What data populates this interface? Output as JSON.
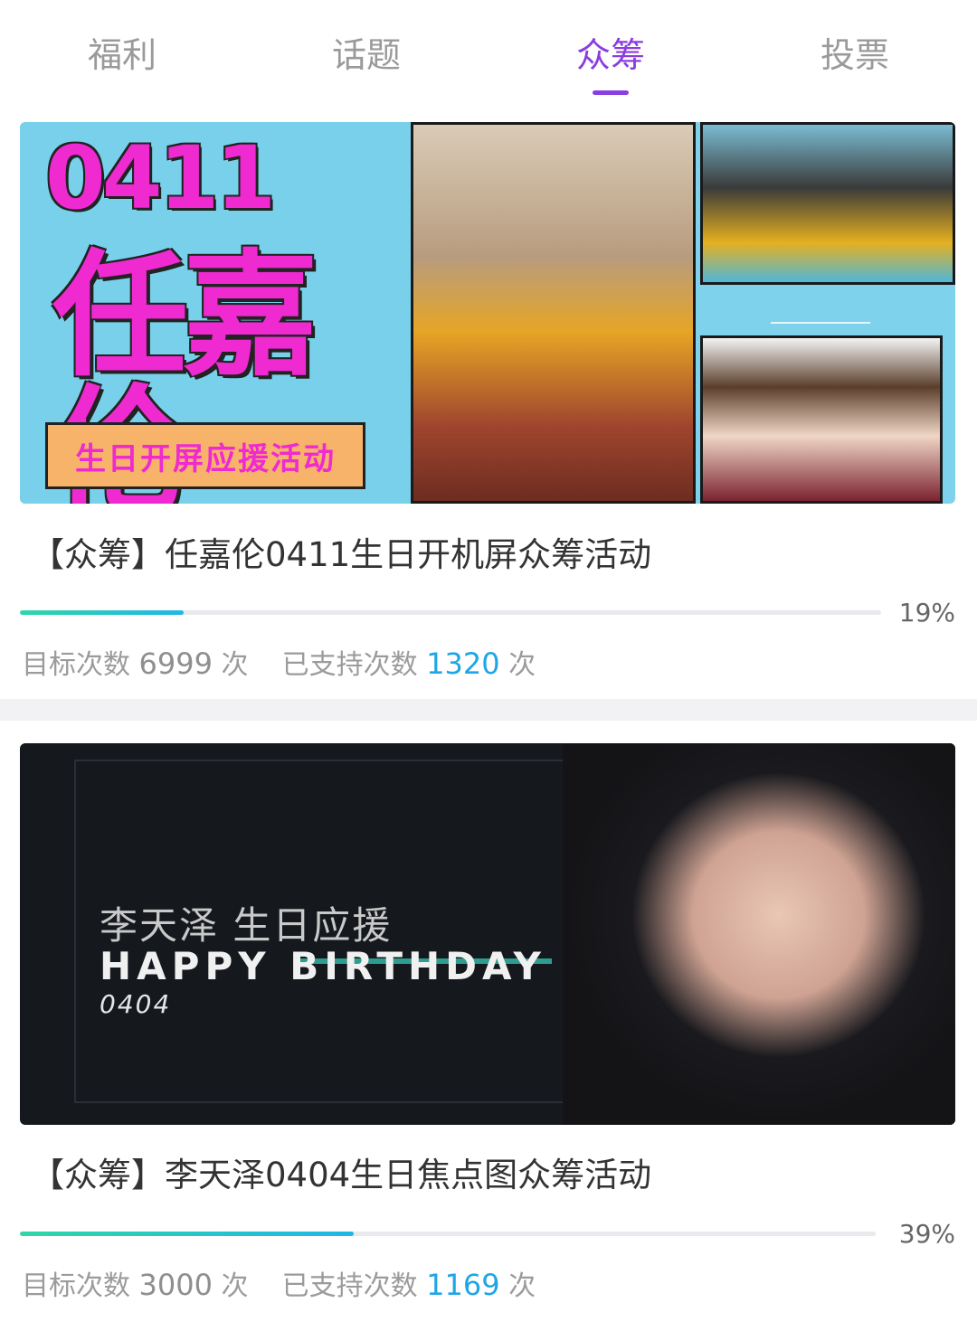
{
  "tabs": [
    {
      "label": "福利",
      "active": false
    },
    {
      "label": "话题",
      "active": false
    },
    {
      "label": "众筹",
      "active": true
    },
    {
      "label": "投票",
      "active": false
    }
  ],
  "accent_color": "#8a3de0",
  "progress_color": "#20b7e6",
  "campaigns": [
    {
      "banner": {
        "headline_number": "0411",
        "headline_name": "任嘉伦",
        "subtitle": "生日开屏应援活动"
      },
      "title": "【众筹】任嘉伦0411生日开机屏众筹活动",
      "progress_percent": 19,
      "progress_label": "19%",
      "target_label": "目标次数",
      "target_value": "6999",
      "support_label": "已支持次数",
      "support_value": "1320",
      "unit": "次"
    },
    {
      "banner": {
        "subtitle": "李天泽 生日应援",
        "headline": "HAPPY BIRTHDAY",
        "date": "0404"
      },
      "title": "【众筹】李天泽0404生日焦点图众筹活动",
      "progress_percent": 39,
      "progress_label": "39%",
      "target_label": "目标次数",
      "target_value": "3000",
      "support_label": "已支持次数",
      "support_value": "1169",
      "unit": "次"
    }
  ]
}
